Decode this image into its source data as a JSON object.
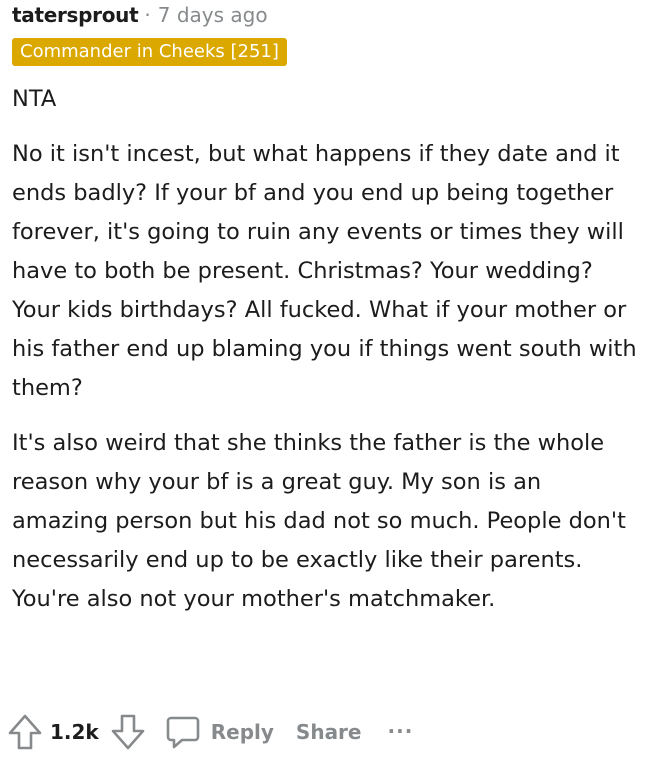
{
  "comment": {
    "username": "tatersprout",
    "separator": "·",
    "timestamp": "7 days ago",
    "flair": {
      "text": "Commander in Cheeks [251]",
      "color": "#dba800"
    },
    "paragraphs": [
      "NTA",
      "No it isn't incest, but what happens if they date and it ends badly? If your bf and you end up being together forever, it's going to ruin any events or times they will have to both be present. Christmas? Your wedding? Your kids birthdays? All fucked. What if your mother or his father end up blaming you if things went south with them?",
      "It's also weird that she thinks the father is the whole reason why your bf is a great guy. My son is an amazing person but his dad not so much. People don't necessarily end up to be exactly like their parents. You're also not your mother's matchmaker."
    ]
  },
  "actions": {
    "upvote_icon": "arrow-up-icon",
    "vote_count": "1.2k",
    "downvote_icon": "arrow-down-icon",
    "reply_icon": "speech-bubble-icon",
    "reply_label": "Reply",
    "share_label": "Share",
    "more_label": "..."
  },
  "colors": {
    "text": "#1c1c1c",
    "muted": "#878a8c",
    "flair_bg": "#dba800"
  }
}
